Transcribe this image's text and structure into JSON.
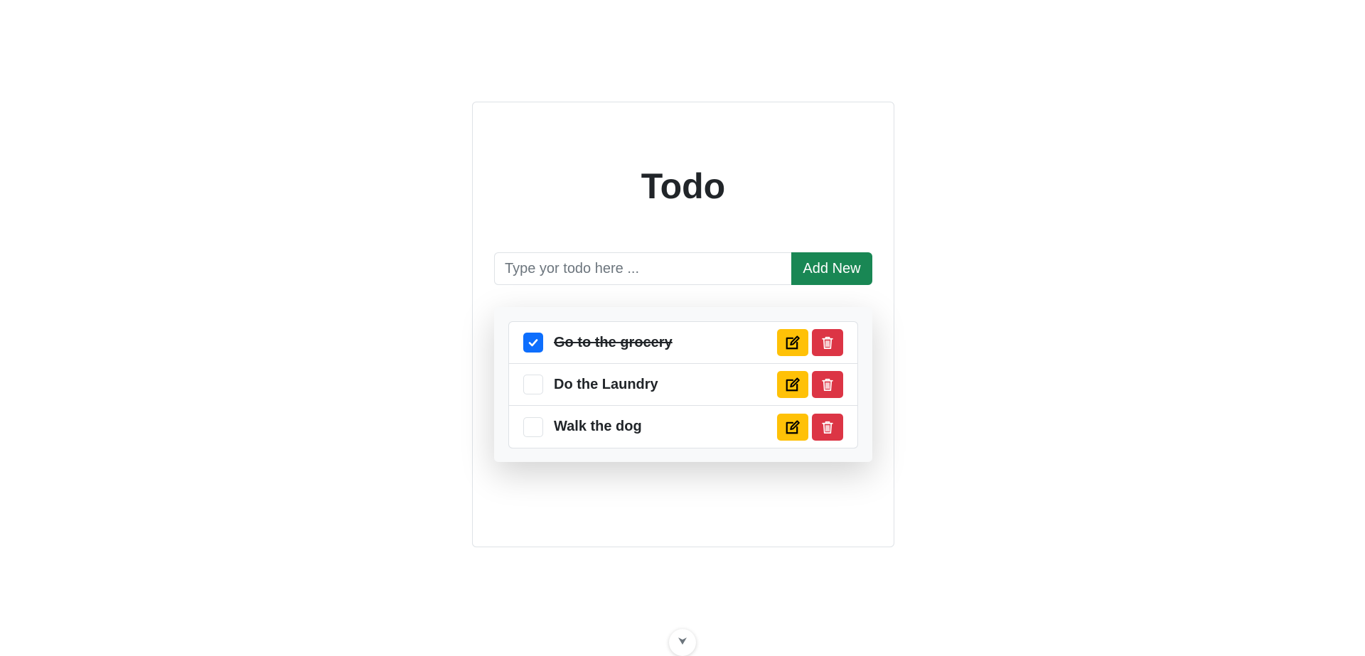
{
  "app": {
    "title": "Todo"
  },
  "new_todo": {
    "placeholder": "Type yor todo here ...",
    "value": "",
    "add_label": "Add New"
  },
  "todos": [
    {
      "text": "Go to the grocery",
      "done": true
    },
    {
      "text": "Do the Laundry",
      "done": false
    },
    {
      "text": "Walk the dog",
      "done": false
    }
  ],
  "icons": {
    "checkbox_checked": "check-icon",
    "edit": "pencil-square-icon",
    "delete": "trash-icon",
    "scroll": "chevron-down-icon"
  },
  "colors": {
    "add_button": "#198754",
    "edit_button": "#ffc107",
    "delete_button": "#dc3545",
    "checkbox_checked": "#0d6efd"
  }
}
